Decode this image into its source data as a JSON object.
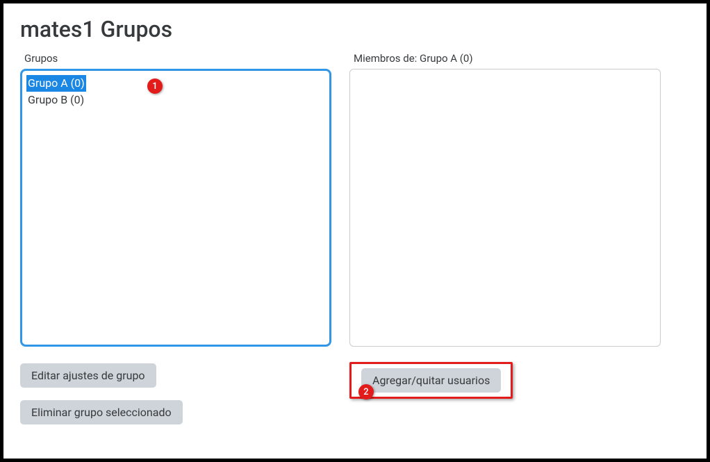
{
  "title": "mates1 Grupos",
  "left": {
    "label": "Grupos",
    "items": [
      {
        "label": "Grupo A (0)",
        "selected": true
      },
      {
        "label": "Grupo B (0)",
        "selected": false
      }
    ],
    "buttons": {
      "edit": "Editar ajustes de grupo",
      "delete": "Eliminar grupo seleccionado"
    }
  },
  "right": {
    "label": "Miembros de: Grupo A (0)",
    "buttons": {
      "addremove": "Agregar/quitar usuarios"
    }
  },
  "callouts": {
    "one": "1",
    "two": "2"
  }
}
